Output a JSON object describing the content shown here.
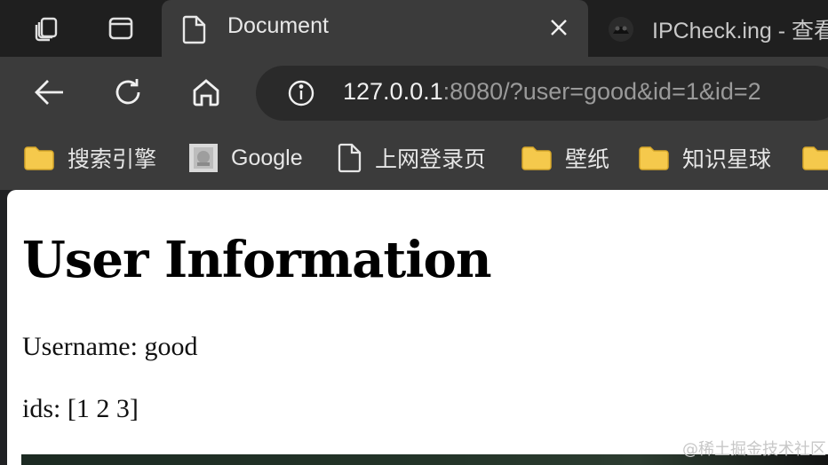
{
  "tabs": {
    "active": {
      "title": "Document",
      "icon": "document-icon"
    },
    "inactive": {
      "title": "IPCheck.ing - 查看",
      "icon": "site-icon"
    }
  },
  "toolbar": {
    "url_host": "127.0.0.1",
    "url_rest": ":8080/?user=good&id=1&id=2"
  },
  "bookmarks": [
    {
      "label": "搜索引擎",
      "icon": "folder-icon"
    },
    {
      "label": "Google",
      "icon": "google-favicon-icon"
    },
    {
      "label": "上网登录页",
      "icon": "page-icon"
    },
    {
      "label": "壁纸",
      "icon": "folder-icon"
    },
    {
      "label": "知识星球",
      "icon": "folder-icon"
    }
  ],
  "page": {
    "heading": "User Information",
    "username_line": "Username: good",
    "ids_line": "ids: [1 2 3]"
  },
  "watermark": "@稀土掘金技术社区",
  "colors": {
    "tab_strip": "#1f1f1f",
    "toolbar": "#3b3b3b",
    "folder": "#f5c94c",
    "page_bg": "#ffffff"
  }
}
